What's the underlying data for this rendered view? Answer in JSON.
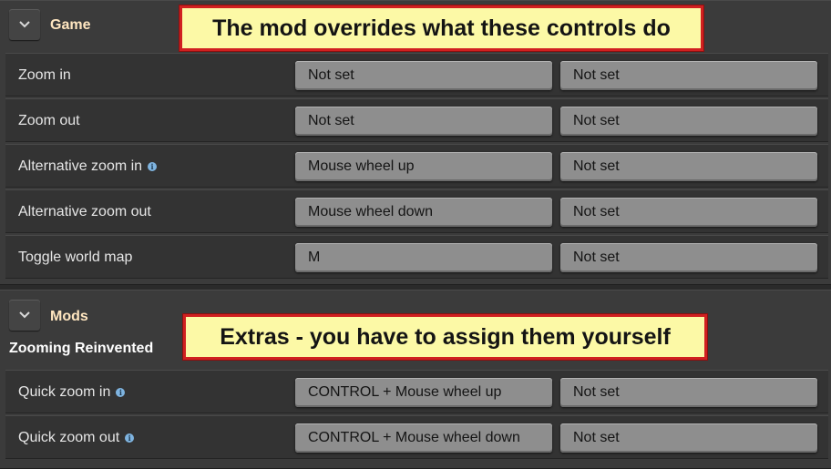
{
  "game_section": {
    "title": "Game",
    "rows": [
      {
        "label": "Zoom in",
        "has_info": false,
        "primary": "Not set",
        "secondary": "Not set"
      },
      {
        "label": "Zoom out",
        "has_info": false,
        "primary": "Not set",
        "secondary": "Not set"
      },
      {
        "label": "Alternative zoom in",
        "has_info": true,
        "primary": "Mouse wheel up",
        "secondary": "Not set"
      },
      {
        "label": "Alternative zoom out",
        "has_info": false,
        "primary": "Mouse wheel down",
        "secondary": "Not set"
      },
      {
        "label": "Toggle world map",
        "has_info": false,
        "primary": "M",
        "secondary": "Not set"
      }
    ]
  },
  "mods_section": {
    "title": "Mods",
    "mod_name": "Zooming Reinvented",
    "rows": [
      {
        "label": "Quick zoom in",
        "has_info": true,
        "primary": "CONTROL + Mouse wheel up",
        "secondary": "Not set"
      },
      {
        "label": "Quick zoom out",
        "has_info": true,
        "primary": "CONTROL + Mouse wheel down",
        "secondary": "Not set"
      }
    ]
  },
  "callouts": {
    "top": "The mod overrides what these controls do",
    "bottom": "Extras - you have to assign them yourself"
  },
  "icons": {
    "collapse": "chevron-down-icon",
    "info": "info-icon"
  },
  "colors": {
    "callout_bg": "#fcf9a6",
    "callout_border": "#d02020",
    "section_title": "#ffe6c0"
  }
}
